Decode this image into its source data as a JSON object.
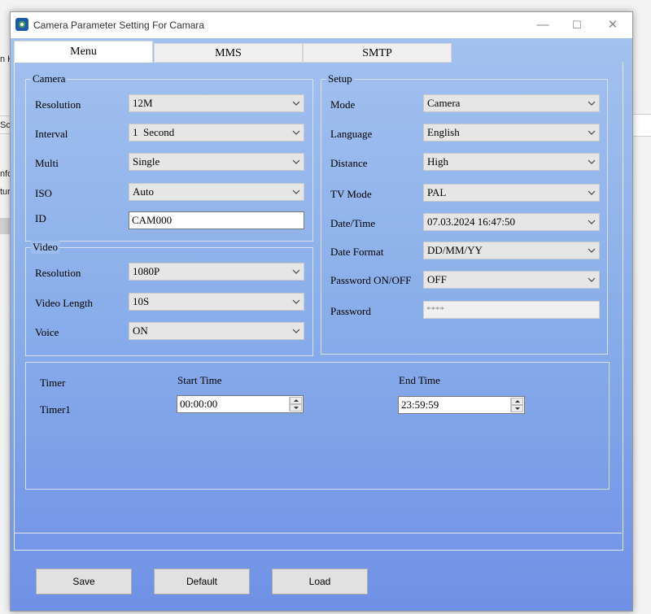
{
  "window": {
    "title": "Camera Parameter Setting For  Camara"
  },
  "background_fragments": [
    "n K",
    "Sc",
    "nfo",
    "tur"
  ],
  "tabs": [
    {
      "label": "Menu",
      "active": true
    },
    {
      "label": "MMS",
      "active": false
    },
    {
      "label": "SMTP",
      "active": false
    }
  ],
  "camera": {
    "title": "Camera",
    "resolution": {
      "label": "Resolution",
      "value": "12M"
    },
    "interval": {
      "label": "Interval",
      "value": "1  Second"
    },
    "multi": {
      "label": "Multi",
      "value": "Single"
    },
    "iso": {
      "label": "ISO",
      "value": "Auto"
    },
    "id": {
      "label": "ID",
      "value": "CAM000"
    }
  },
  "video": {
    "title": "Video",
    "resolution": {
      "label": "Resolution",
      "value": "1080P"
    },
    "length": {
      "label": "Video Length",
      "value": "10S"
    },
    "voice": {
      "label": "Voice",
      "value": "ON"
    }
  },
  "setup": {
    "title": "Setup",
    "mode": {
      "label": "Mode",
      "value": "Camera"
    },
    "language": {
      "label": "Language",
      "value": "English"
    },
    "distance": {
      "label": "Distance",
      "value": "High"
    },
    "tvmode": {
      "label": "TV Mode",
      "value": "PAL"
    },
    "datetime": {
      "label": "Date/Time",
      "value": "07.03.2024 16:47:50"
    },
    "dateformat": {
      "label": "Date Format",
      "value": "DD/MM/YY"
    },
    "password_onoff": {
      "label": "Password ON/OFF",
      "value": "OFF"
    },
    "password": {
      "label": "Password",
      "value": "****"
    }
  },
  "timer": {
    "label": "Timer",
    "start_label": "Start Time",
    "end_label": "End Time",
    "timer1": {
      "label": "Timer1",
      "start": "00:00:00",
      "end": "23:59:59"
    }
  },
  "buttons": {
    "save": "Save",
    "default": "Default",
    "load": "Load"
  },
  "icons": {
    "app": "camera-app-icon",
    "minimize": "minimize-icon",
    "maximize": "maximize-icon",
    "close": "close-icon",
    "dropdown": "chevron-down-icon"
  }
}
